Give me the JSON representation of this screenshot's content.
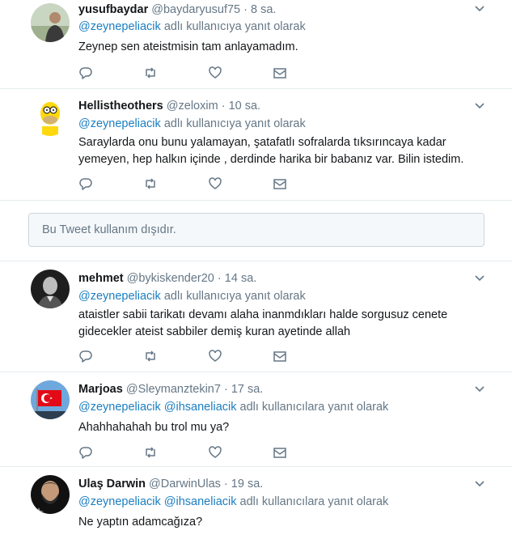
{
  "reply_word": "adlı kullanıcıya yanıt olarak",
  "reply_word_plural": "adlı kullanıcılara yanıt olarak",
  "colors": {
    "link": "#1b7ec0",
    "muted": "#657786",
    "text": "#14171a",
    "border": "#e6ecf0"
  },
  "tweets": [
    {
      "name": "yusufbaydar",
      "handle": "@baydaryusuf75",
      "sep": "·",
      "time": "8 sa.",
      "mentions": "@zeynepeliacik",
      "reply_label": "adlı kullanıcıya yanıt olarak",
      "text": "Zeynep sen ateistmisin tam anlayamadım.",
      "avatar": "man-portrait-avatar"
    },
    {
      "name": "Hellistheothers",
      "handle": "@zeloxim",
      "sep": "·",
      "time": "10 sa.",
      "mentions": "@zeynepeliacik",
      "reply_label": "adlı kullanıcıya yanıt olarak",
      "text": "Saraylarda onu bunu yalamayan, şatafatlı sofralarda tıksırıncaya kadar yemeyen, hep halkın içinde , derdinde harika bir babanız var. Bilin istedim.",
      "avatar": "cartoon-character-avatar"
    },
    {
      "name": "mehmet",
      "handle": "@bykiskender20",
      "sep": "·",
      "time": "14 sa.",
      "mentions": "@zeynepeliacik",
      "reply_label": "adlı kullanıcıya yanıt olarak",
      "text": "ataistler sabii tarikatı devamı  alaha inanmdıkları halde  sorgusuz cenete gidecekler ateist sabbiler demiş kuran ayetinde allah",
      "avatar": "black-white-portrait-avatar"
    },
    {
      "name": "Marjoas",
      "handle": "@Sleymanztekin7",
      "sep": "·",
      "time": "17 sa.",
      "mentions": "@zeynepeliacik @ihsaneliacik",
      "reply_label": "adlı kullanıcılara yanıt olarak",
      "text": "Ahahhahahah bu trol mu ya?",
      "avatar": "flag-avatar"
    },
    {
      "name": "Ulaş Darwin",
      "handle": "@DarwinUlas",
      "sep": "·",
      "time": "19 sa.",
      "mentions": "@zeynepeliacik @ihsaneliacik",
      "reply_label": "adlı kullanıcılara yanıt olarak",
      "text": "Ne yaptın adamcağıza?",
      "avatar": "bearded-man-avatar"
    }
  ],
  "withheld_notice": "Bu Tweet kullanım dışıdır.",
  "action_icons": [
    "reply-icon",
    "retweet-icon",
    "like-icon",
    "direct-message-icon"
  ]
}
